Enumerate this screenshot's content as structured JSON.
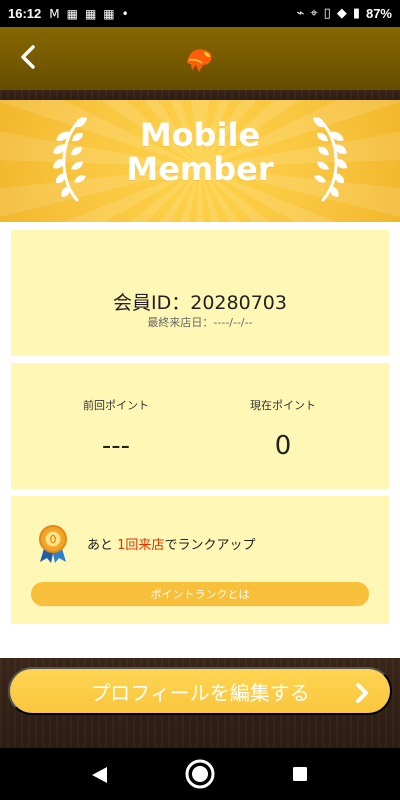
{
  "status_bar": {
    "time": "16:12",
    "battery": "87%",
    "left_icons": [
      "gmail-icon",
      "store-icon",
      "store-icon",
      "store-icon",
      "dot-icon"
    ],
    "right_icons": [
      "nfc-icon",
      "location-icon",
      "vibrate-icon",
      "wifi-icon",
      "battery-icon"
    ]
  },
  "header": {
    "back_icon": "chevron-left-icon",
    "logo_icon": "monkey-logo-icon"
  },
  "banner": {
    "title_line1": "Mobile",
    "title_line2": "Member",
    "decoration_icon": "laurel-icon"
  },
  "member_card": {
    "member_id_label": "会員ID：",
    "member_id": "20280703",
    "last_visit_label": "最終来店日：",
    "last_visit_value": "----/--/--"
  },
  "points_card": {
    "previous_label": "前回ポイント",
    "previous_value": "---",
    "current_label": "現在ポイント",
    "current_value": "0"
  },
  "rank_card": {
    "medal_value": "0",
    "prefix": "あと",
    "highlight": "1回来店",
    "suffix": "でランクアップ",
    "button_label": "ポイントランクとは"
  },
  "cta": {
    "label": "プロフィールを編集する",
    "arrow_icon": "chevron-right-icon"
  },
  "nav": {
    "back_icon": "triangle-back-icon",
    "home_icon": "home-circle-icon",
    "recent_icon": "square-recent-icon"
  },
  "colors": {
    "header": "#7a5e00",
    "banner": "#f9c640",
    "card": "#fff7b5",
    "button": "#f8bf3a",
    "highlight": "#e53300",
    "wood": "#2f1f14"
  }
}
